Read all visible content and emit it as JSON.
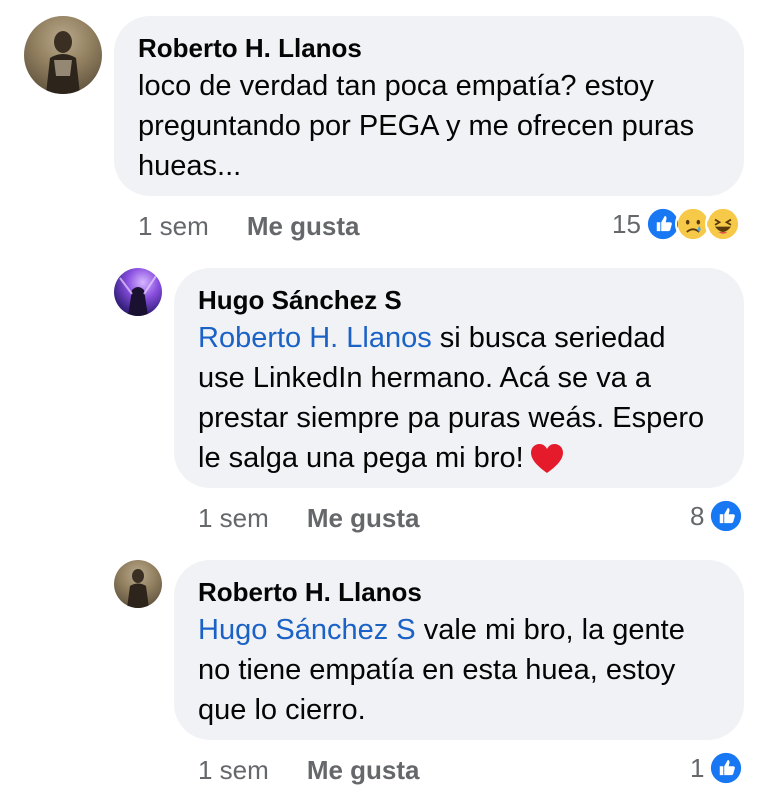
{
  "comments": [
    {
      "author": "Roberto H. Llanos",
      "text": "loco de verdad tan poca empatía? estoy preguntando por PEGA y me ofrecen puras hueas...",
      "time": "1 sem",
      "like_label": "Me gusta",
      "reaction_count": "15",
      "reactions": [
        "like-icon",
        "sad-icon",
        "haha-icon"
      ]
    },
    {
      "author": "Hugo Sánchez S",
      "mention": "Roberto H. Llanos",
      "text_line1": " si busca seriedad",
      "text_rest": "use LinkedIn hermano. Acá se va a prestar siempre pa puras weás. Espero le salga una pega mi bro!",
      "emoji": "heart-emoji",
      "time": "1 sem",
      "like_label": "Me gusta",
      "reaction_count": "8",
      "reactions": [
        "like-icon"
      ]
    },
    {
      "author": "Roberto H. Llanos",
      "mention": "Hugo Sánchez S",
      "text_line1": " vale mi bro, la gente",
      "text_rest": "no tiene empatía en esta huea, estoy que lo cierro.",
      "time": "1 sem",
      "like_label": "Me gusta",
      "reaction_count": "1",
      "reactions": [
        "like-icon"
      ]
    }
  ],
  "colors": {
    "bubble_bg": "#f0f2f5",
    "mention": "#1b62c6",
    "like_blue": "#1877f2",
    "muted": "#65676b"
  }
}
